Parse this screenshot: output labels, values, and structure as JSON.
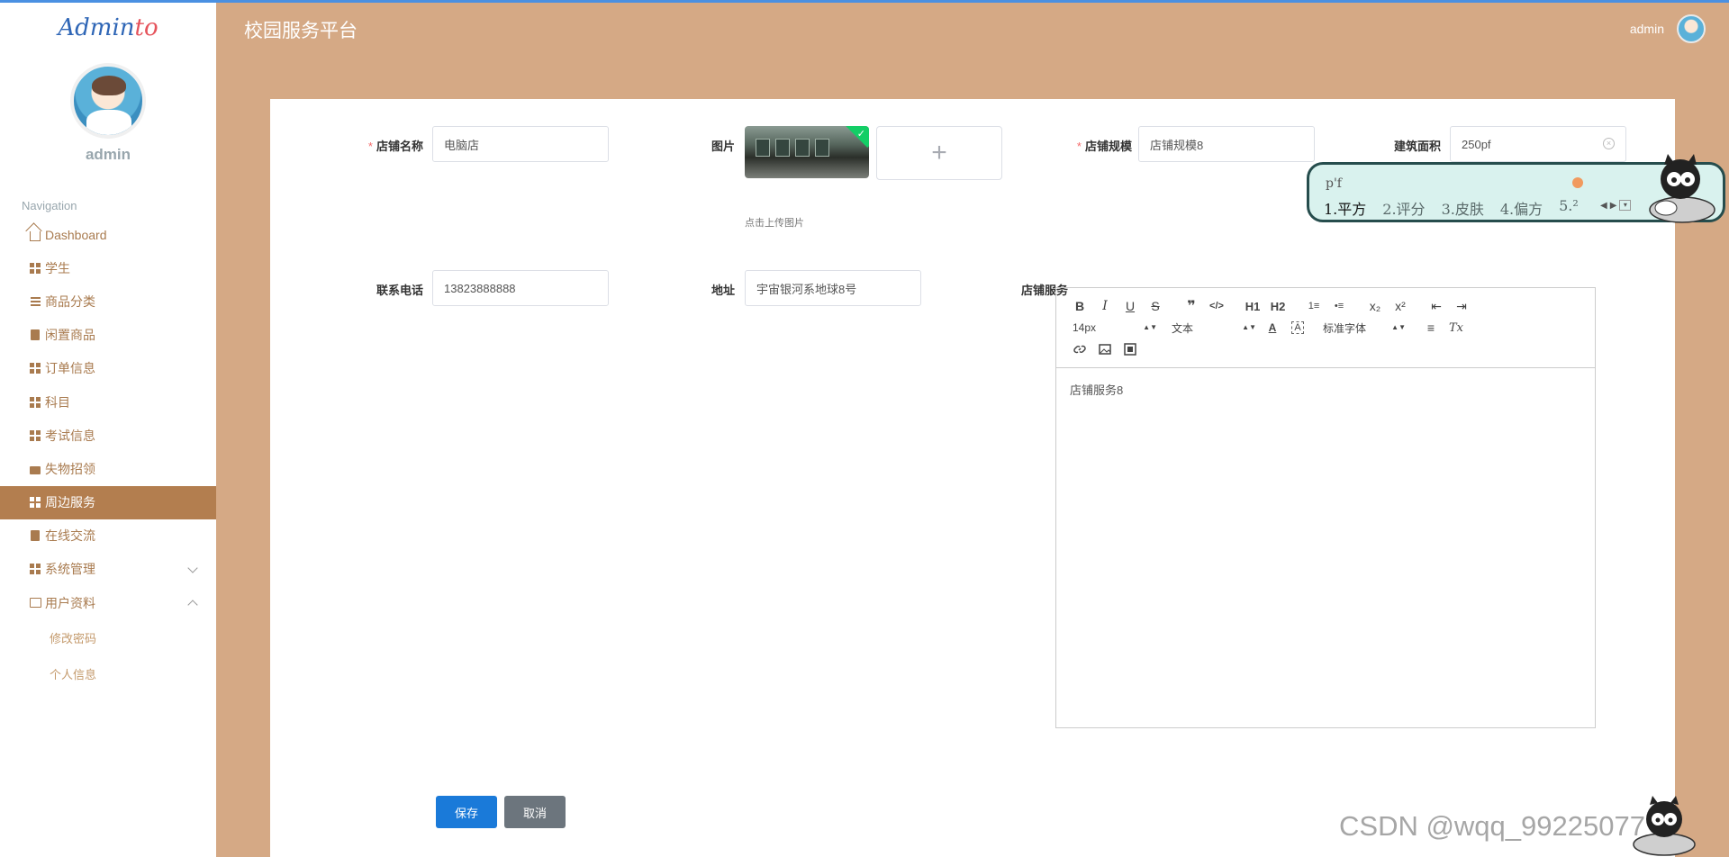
{
  "brand": {
    "prefix": "Admin",
    "accent": "to"
  },
  "sidebar": {
    "username": "admin",
    "nav_title": "Navigation",
    "items": [
      {
        "label": "Dashboard",
        "icon": "home-icon"
      },
      {
        "label": "学生",
        "icon": "grid-icon"
      },
      {
        "label": "商品分类",
        "icon": "list-icon"
      },
      {
        "label": "闲置商品",
        "icon": "clipboard-icon"
      },
      {
        "label": "订单信息",
        "icon": "grid-icon"
      },
      {
        "label": "科目",
        "icon": "grid-icon"
      },
      {
        "label": "考试信息",
        "icon": "grid-icon"
      },
      {
        "label": "失物招领",
        "icon": "briefcase-icon"
      },
      {
        "label": "周边服务",
        "icon": "grid-icon",
        "active": true
      },
      {
        "label": "在线交流",
        "icon": "clipboard-icon"
      },
      {
        "label": "系统管理",
        "icon": "grid-icon"
      },
      {
        "label": "用户资料",
        "icon": "card-icon"
      }
    ],
    "sub_items": [
      "修改密码",
      "个人信息"
    ]
  },
  "header": {
    "title": "校园服务平台",
    "user": "admin"
  },
  "form": {
    "shop_name": {
      "label": "店铺名称",
      "value": "电脑店",
      "required": true
    },
    "image": {
      "label": "图片",
      "hint": "点击上传图片",
      "add": "+"
    },
    "scale": {
      "label": "店铺规模",
      "value": "店铺规模8",
      "required": true
    },
    "area": {
      "label": "建筑面积",
      "value": "250pf"
    },
    "phone": {
      "label": "联系电话",
      "value": "13823888888"
    },
    "address": {
      "label": "地址",
      "value": "宇宙银河系地球8号"
    },
    "service": {
      "label": "店铺服务",
      "content": "店铺服务8"
    }
  },
  "editor": {
    "toolbar_row1": [
      "B",
      "I",
      "U",
      "S",
      "❞",
      "</>",
      "H1",
      "H2",
      "1≡",
      "•≡",
      "x₂",
      "x²",
      "⇤",
      "⇥"
    ],
    "font_size": "14px",
    "header_select": "文本",
    "font_family": "标准字体",
    "color_btn": "A",
    "bg_btn": "A",
    "align_btn": "≡",
    "clean_btn": "Tx"
  },
  "buttons": {
    "save": "保存",
    "cancel": "取消"
  },
  "ime": {
    "pinyin": "p'f",
    "candidates": [
      "1.平方",
      "2.评分",
      "3.皮肤",
      "4.偏方",
      "5.²"
    ]
  },
  "watermark": "CSDN @wqq_99225077",
  "colors": {
    "background": "#d5a985",
    "active_menu": "#b37e4f",
    "primary": "#1a7ad9",
    "secondary": "#6c757d",
    "required": "#f56c6c"
  }
}
